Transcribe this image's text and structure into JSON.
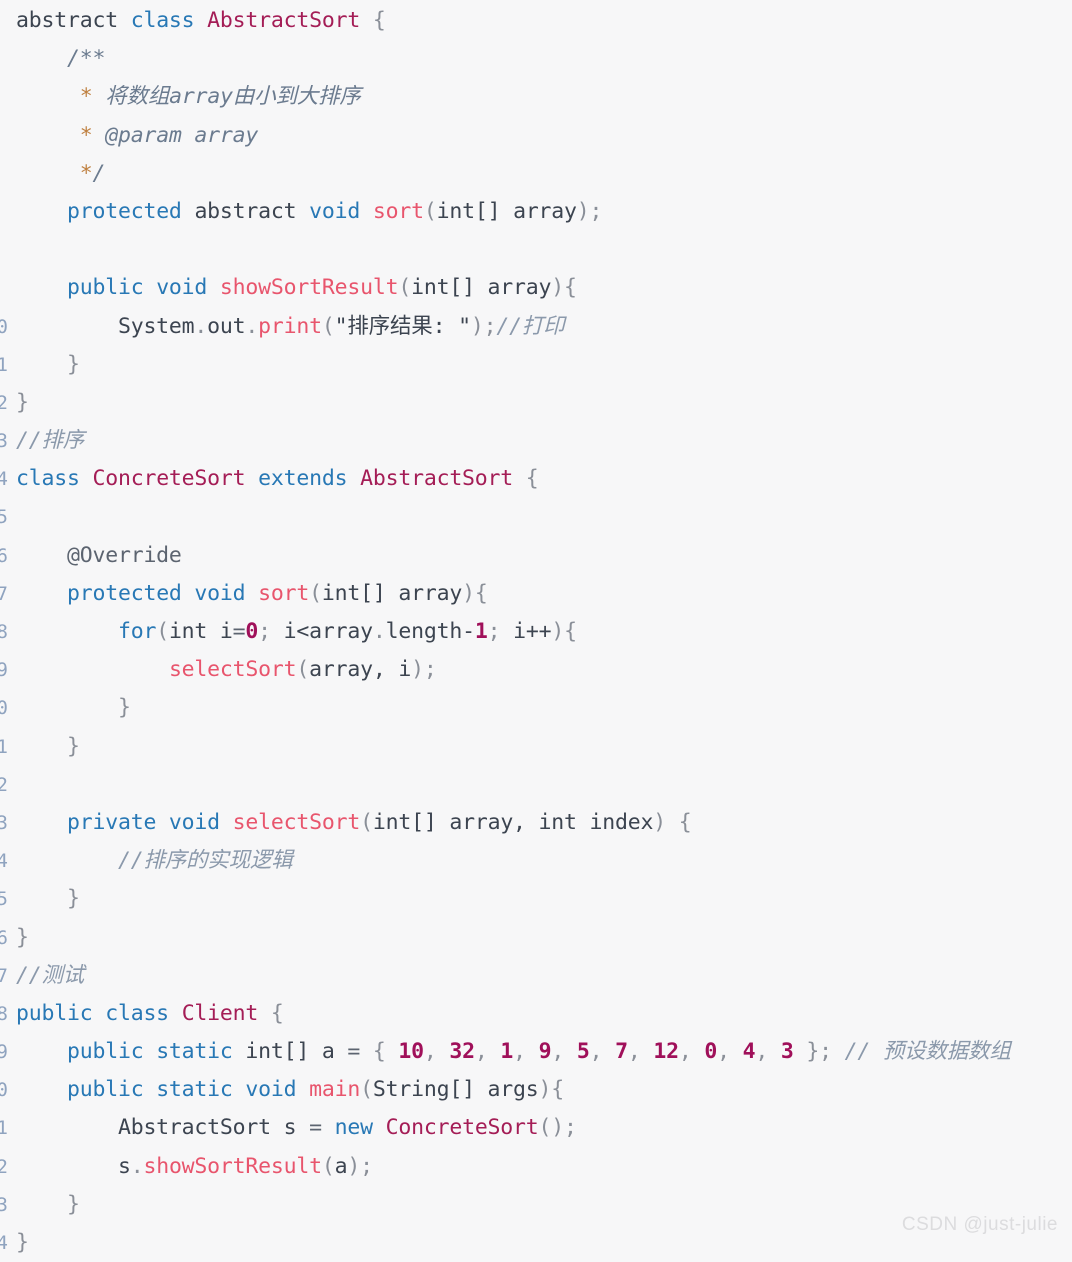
{
  "editor": {
    "background_color": "#f7f7f8",
    "gutter_color": "#8fa3bf",
    "language": "java",
    "total_lines": 24
  },
  "theme": {
    "keyword": "#2878b5",
    "type_name": "#a41d56",
    "function_name": "#e8556d",
    "number": "#a0105a",
    "comment": "#8b99ab",
    "doc_comment": "#6b7b8f",
    "doc_star": "#bf8040",
    "punctuation": "#8a8f98",
    "plain_text": "#3c4450"
  },
  "watermark": {
    "text": "CSDN @just-julie"
  },
  "lines": [
    {
      "number": "",
      "tokens": [
        {
          "t": "plain",
          "v": "abstract "
        },
        {
          "t": "kw",
          "v": "class "
        },
        {
          "t": "type",
          "v": "AbstractSort"
        },
        {
          "t": "punct",
          "v": " {"
        }
      ]
    },
    {
      "number": "",
      "tokens": [
        {
          "t": "doc",
          "v": "    /**"
        }
      ]
    },
    {
      "number": "",
      "tokens": [
        {
          "t": "doc",
          "v": "     "
        },
        {
          "t": "docstar",
          "v": "*"
        },
        {
          "t": "doc",
          "v": " 将数组array由小到大排序"
        }
      ]
    },
    {
      "number": "",
      "tokens": [
        {
          "t": "doc",
          "v": "     "
        },
        {
          "t": "docstar",
          "v": "*"
        },
        {
          "t": "doc",
          "v": " @param array"
        }
      ]
    },
    {
      "number": "",
      "tokens": [
        {
          "t": "doc",
          "v": "     "
        },
        {
          "t": "docstar",
          "v": "*"
        },
        {
          "t": "doc",
          "v": "/"
        }
      ]
    },
    {
      "number": "",
      "tokens": [
        {
          "t": "plain",
          "v": "    "
        },
        {
          "t": "kw",
          "v": "protected "
        },
        {
          "t": "plain",
          "v": "abstract "
        },
        {
          "t": "kw",
          "v": "void "
        },
        {
          "t": "fn",
          "v": "sort"
        },
        {
          "t": "punct",
          "v": "("
        },
        {
          "t": "plain",
          "v": "int[] array"
        },
        {
          "t": "punct",
          "v": ");"
        }
      ]
    },
    {
      "number": "",
      "tokens": []
    },
    {
      "number": "",
      "tokens": [
        {
          "t": "plain",
          "v": "    "
        },
        {
          "t": "kw",
          "v": "public void "
        },
        {
          "t": "fn",
          "v": "showSortResult"
        },
        {
          "t": "punct",
          "v": "("
        },
        {
          "t": "plain",
          "v": "int[] array"
        },
        {
          "t": "punct",
          "v": "){"
        }
      ]
    },
    {
      "number": "0",
      "tokens": [
        {
          "t": "plain",
          "v": "        System"
        },
        {
          "t": "punct",
          "v": "."
        },
        {
          "t": "plain",
          "v": "out"
        },
        {
          "t": "punct",
          "v": "."
        },
        {
          "t": "fn",
          "v": "print"
        },
        {
          "t": "punct",
          "v": "("
        },
        {
          "t": "str",
          "v": "\"排序结果: \""
        },
        {
          "t": "punct",
          "v": ");"
        },
        {
          "t": "cmt",
          "v": "//打印"
        }
      ]
    },
    {
      "number": "1",
      "tokens": [
        {
          "t": "punct",
          "v": "    }"
        }
      ]
    },
    {
      "number": "2",
      "tokens": [
        {
          "t": "punct",
          "v": "}"
        }
      ]
    },
    {
      "number": "3",
      "tokens": [
        {
          "t": "cmt",
          "v": "//排序"
        }
      ]
    },
    {
      "number": "4",
      "tokens": [
        {
          "t": "kw",
          "v": "class "
        },
        {
          "t": "type",
          "v": "ConcreteSort "
        },
        {
          "t": "kw",
          "v": "extends "
        },
        {
          "t": "type",
          "v": "AbstractSort"
        },
        {
          "t": "punct",
          "v": " {"
        }
      ]
    },
    {
      "number": "5",
      "tokens": []
    },
    {
      "number": "6",
      "tokens": [
        {
          "t": "ann",
          "v": "    @Override"
        }
      ]
    },
    {
      "number": "7",
      "tokens": [
        {
          "t": "plain",
          "v": "    "
        },
        {
          "t": "kw",
          "v": "protected void "
        },
        {
          "t": "fn",
          "v": "sort"
        },
        {
          "t": "punct",
          "v": "("
        },
        {
          "t": "plain",
          "v": "int[] array"
        },
        {
          "t": "punct",
          "v": "){"
        }
      ]
    },
    {
      "number": "8",
      "tokens": [
        {
          "t": "plain",
          "v": "        "
        },
        {
          "t": "kw",
          "v": "for"
        },
        {
          "t": "punct",
          "v": "("
        },
        {
          "t": "plain",
          "v": "int i"
        },
        {
          "t": "op",
          "v": "="
        },
        {
          "t": "num",
          "v": "0"
        },
        {
          "t": "punct",
          "v": "; "
        },
        {
          "t": "plain",
          "v": "i<array"
        },
        {
          "t": "punct",
          "v": "."
        },
        {
          "t": "plain",
          "v": "length-"
        },
        {
          "t": "num",
          "v": "1"
        },
        {
          "t": "punct",
          "v": "; "
        },
        {
          "t": "plain",
          "v": "i++"
        },
        {
          "t": "punct",
          "v": "){"
        }
      ]
    },
    {
      "number": "9",
      "tokens": [
        {
          "t": "plain",
          "v": "            "
        },
        {
          "t": "fn",
          "v": "selectSort"
        },
        {
          "t": "punct",
          "v": "("
        },
        {
          "t": "plain",
          "v": "array, i"
        },
        {
          "t": "punct",
          "v": ");"
        }
      ]
    },
    {
      "number": "0",
      "tokens": [
        {
          "t": "punct",
          "v": "        }"
        }
      ]
    },
    {
      "number": "1",
      "tokens": [
        {
          "t": "punct",
          "v": "    }"
        }
      ]
    },
    {
      "number": "2",
      "tokens": []
    },
    {
      "number": "3",
      "tokens": [
        {
          "t": "plain",
          "v": "    "
        },
        {
          "t": "kw",
          "v": "private void "
        },
        {
          "t": "fn",
          "v": "selectSort"
        },
        {
          "t": "punct",
          "v": "("
        },
        {
          "t": "plain",
          "v": "int[] array, int index"
        },
        {
          "t": "punct",
          "v": ") {"
        }
      ]
    },
    {
      "number": "4",
      "tokens": [
        {
          "t": "cmt",
          "v": "        //排序的实现逻辑"
        }
      ]
    },
    {
      "number": "5",
      "tokens": [
        {
          "t": "punct",
          "v": "    }"
        }
      ]
    },
    {
      "number": "6",
      "tokens": [
        {
          "t": "punct",
          "v": "}"
        }
      ]
    },
    {
      "number": "7",
      "tokens": [
        {
          "t": "cmt",
          "v": "//测试"
        }
      ]
    },
    {
      "number": "8",
      "tokens": [
        {
          "t": "kw",
          "v": "public class "
        },
        {
          "t": "type",
          "v": "Client"
        },
        {
          "t": "punct",
          "v": " {"
        }
      ]
    },
    {
      "number": "9",
      "tokens": [
        {
          "t": "plain",
          "v": "    "
        },
        {
          "t": "kw",
          "v": "public static "
        },
        {
          "t": "plain",
          "v": "int[] a "
        },
        {
          "t": "op",
          "v": "= "
        },
        {
          "t": "punct",
          "v": "{ "
        },
        {
          "t": "num",
          "v": "10"
        },
        {
          "t": "punct",
          "v": ", "
        },
        {
          "t": "num",
          "v": "32"
        },
        {
          "t": "punct",
          "v": ", "
        },
        {
          "t": "num",
          "v": "1"
        },
        {
          "t": "punct",
          "v": ", "
        },
        {
          "t": "num",
          "v": "9"
        },
        {
          "t": "punct",
          "v": ", "
        },
        {
          "t": "num",
          "v": "5"
        },
        {
          "t": "punct",
          "v": ", "
        },
        {
          "t": "num",
          "v": "7"
        },
        {
          "t": "punct",
          "v": ", "
        },
        {
          "t": "num",
          "v": "12"
        },
        {
          "t": "punct",
          "v": ", "
        },
        {
          "t": "num",
          "v": "0"
        },
        {
          "t": "punct",
          "v": ", "
        },
        {
          "t": "num",
          "v": "4"
        },
        {
          "t": "punct",
          "v": ", "
        },
        {
          "t": "num",
          "v": "3"
        },
        {
          "t": "punct",
          "v": " }; "
        },
        {
          "t": "cmt",
          "v": "// 预设数据数组"
        }
      ]
    },
    {
      "number": "0",
      "tokens": [
        {
          "t": "plain",
          "v": "    "
        },
        {
          "t": "kw",
          "v": "public static void "
        },
        {
          "t": "fn",
          "v": "main"
        },
        {
          "t": "punct",
          "v": "("
        },
        {
          "t": "plain",
          "v": "String[] args"
        },
        {
          "t": "punct",
          "v": "){"
        }
      ]
    },
    {
      "number": "1",
      "tokens": [
        {
          "t": "plain",
          "v": "        AbstractSort s "
        },
        {
          "t": "op",
          "v": "= "
        },
        {
          "t": "kw",
          "v": "new "
        },
        {
          "t": "type",
          "v": "ConcreteSort"
        },
        {
          "t": "punct",
          "v": "();"
        }
      ]
    },
    {
      "number": "2",
      "tokens": [
        {
          "t": "plain",
          "v": "        s"
        },
        {
          "t": "punct",
          "v": "."
        },
        {
          "t": "fn",
          "v": "showSortResult"
        },
        {
          "t": "punct",
          "v": "("
        },
        {
          "t": "plain",
          "v": "a"
        },
        {
          "t": "punct",
          "v": ");"
        }
      ]
    },
    {
      "number": "3",
      "tokens": [
        {
          "t": "punct",
          "v": "    }"
        }
      ]
    },
    {
      "number": "4",
      "tokens": [
        {
          "t": "punct",
          "v": "}"
        }
      ]
    }
  ]
}
